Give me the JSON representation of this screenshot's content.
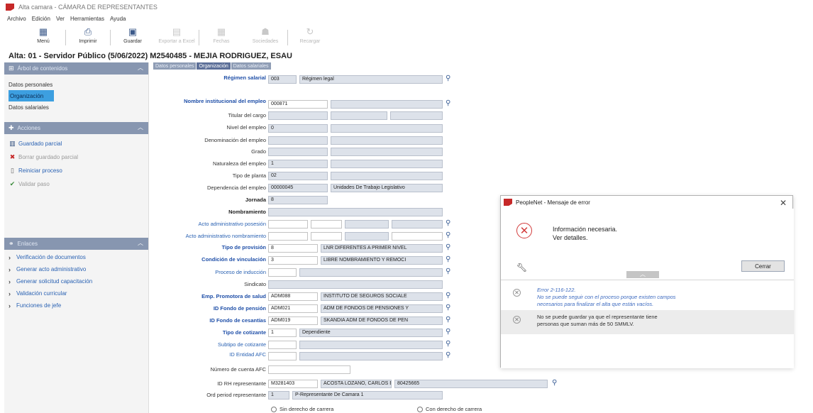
{
  "window": {
    "title": "Alta camara - CÁMARA DE REPRESENTANTES"
  },
  "menu": [
    "Archivo",
    "Edición",
    "Ver",
    "Herramientas",
    "Ayuda"
  ],
  "toolbar": {
    "menu": "Menú",
    "print": "Imprimir",
    "save": "Guardar",
    "export_excel": "Exportar a Excel",
    "dates": "Fechas",
    "partners": "Sociedades",
    "reload": "Recargar"
  },
  "record_title": "Alta: 01 - Servidor Público (5/06/2022)   M2540485 - MEJIA RODRIGUEZ, ESAU",
  "sidebar": {
    "tree_title": "Árbol de contenidos",
    "tree_items": [
      "Datos personales",
      "Organización",
      "Datos salariales"
    ],
    "actions_title": "Acciones",
    "actions": [
      "Guardado parcial",
      "Borrar guardado parcial",
      "Reiniciar proceso",
      "Validar paso"
    ],
    "links_title": "Enlaces",
    "links": [
      "Verificación de documentos",
      "Generar acto administrativo",
      "Generar solicitud capacitación",
      "Validación curricular",
      "Funciones de jefe"
    ]
  },
  "tabs": [
    "Datos personales",
    "Organización",
    "Datos salariales"
  ],
  "form": {
    "regimen_label": "Régimen salarial",
    "regimen_code": "003",
    "regimen_desc": "Régimen legal",
    "nombre_inst_label": "Nombre institucional del empleo",
    "nombre_inst_code": "000871",
    "titular_label": "Titular del cargo",
    "nivel_label": "Nivel del empleo",
    "nivel_val": "0",
    "denominacion_label": "Denominación del empleo",
    "grado_label": "Grado",
    "naturaleza_label": "Naturaleza del empleo",
    "naturaleza_val": "1",
    "tipo_planta_label": "Tipo de planta",
    "tipo_planta_val": "02",
    "dependencia_label": "Dependencia del empleo",
    "dependencia_code": "00000045",
    "dependencia_desc": "Unidades De Trabajo Legislativo",
    "jornada_label": "Jornada",
    "jornada_val": "8",
    "nombramiento_label": "Nombramiento",
    "acto_posesion_label": "Acto administrativo posesión",
    "acto_nombramiento_label": "Acto administrativo nombramiento",
    "tipo_provision_label": "Tipo de provisión",
    "tipo_provision_code": "8",
    "tipo_provision_desc": "LNR DIFERENTES A PRIMER NIVEL",
    "condicion_label": "Condición de vinculación",
    "condicion_code": "3",
    "condicion_desc": "LIBRE NOMBRAMIENTO Y REMOCI",
    "proceso_label": "Proceso de inducción",
    "sindicato_label": "Sindicato",
    "eps_label": "Emp. Promotora de salud",
    "eps_code": "ADM088",
    "eps_desc": "INSTITUTO DE SEGUROS SOCIALE",
    "pension_label": "ID Fondo de pensión",
    "pension_code": "ADM021",
    "pension_desc": "ADM DE FONDOS DE PENSIONES Y",
    "cesantias_label": "ID Fondo de cesantías",
    "cesantias_code": "ADM019",
    "cesantias_desc": "SKANDIA ADM DE FONDOS DE PEN",
    "cotizante_label": "Tipo de cotizante",
    "cotizante_code": "1",
    "cotizante_desc": "Dependiente",
    "subtipo_label": "Subtipo de cotizante",
    "afc_label": "ID Entidad AFC",
    "cuenta_afc_label": "Número de cuenta AFC",
    "rh_label": "ID RH representante",
    "rh_code": "M3281403",
    "rh_name": "ACOSTA LOZANO, CARLOS EDI",
    "rh_id": "80425665",
    "ord_label": "Ord period representante",
    "ord_val": "1",
    "ord_desc": "P-Representante De Camara 1",
    "radio_sin": "Sin derecho de carrera",
    "radio_con": "Con derecho de carrera"
  },
  "dialog": {
    "title": "PeopleNet - Mensaje de error",
    "message_line1": "Información necesaria.",
    "message_line2": "Ver detalles.",
    "close_button": "Cerrar",
    "detail1_line1": "Error 2-116-122.",
    "detail1_line2": "No se puede seguir con el proceso porque existen campos",
    "detail1_line3": "necesarios para finalizar el alta que están vacíos.",
    "detail2_line1": "No se puede guardar ya que el representante tiene",
    "detail2_line2": "personas que suman más de 50 SMMLV."
  }
}
